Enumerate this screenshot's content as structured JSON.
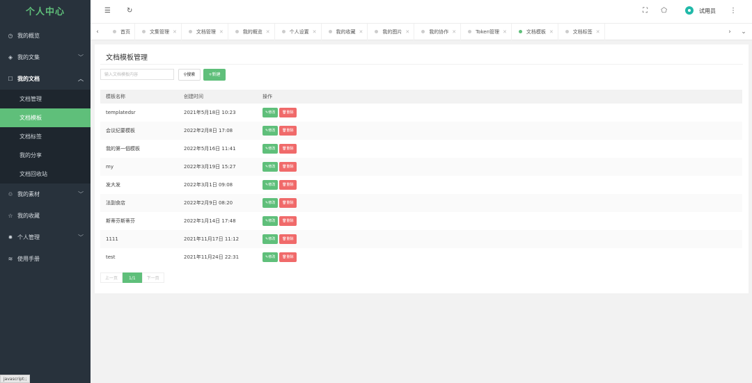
{
  "sidebar": {
    "brand": "个人中心",
    "items": [
      {
        "label": "我的概览",
        "icon": "dashboard-icon"
      },
      {
        "label": "我的文集",
        "icon": "books-icon",
        "has_children": true
      },
      {
        "label": "我的文档",
        "icon": "document-icon",
        "has_children": true,
        "open": true
      }
    ],
    "sub_items": [
      {
        "label": "文档管理",
        "active": false
      },
      {
        "label": "文档模板",
        "active": true
      },
      {
        "label": "文档标签",
        "active": false
      },
      {
        "label": "我的分享",
        "active": false
      },
      {
        "label": "文档回收站",
        "active": false
      }
    ],
    "items_after": [
      {
        "label": "我的素材",
        "icon": "materials-icon",
        "has_children": true
      },
      {
        "label": "我的收藏",
        "icon": "star-icon",
        "has_children": false
      },
      {
        "label": "个人管理",
        "icon": "gear-icon",
        "has_children": true
      },
      {
        "label": "使用手册",
        "icon": "manual-icon",
        "has_children": false
      }
    ],
    "statusbar": "javascript:;"
  },
  "topbar": {
    "user_name": "试用员"
  },
  "tabs": [
    {
      "label": "首页",
      "closable": false,
      "active": false
    },
    {
      "label": "文集管理",
      "closable": true,
      "active": false
    },
    {
      "label": "文档管理",
      "closable": true,
      "active": false
    },
    {
      "label": "我的概览",
      "closable": true,
      "active": false
    },
    {
      "label": "个人设置",
      "closable": true,
      "active": false
    },
    {
      "label": "我的收藏",
      "closable": true,
      "active": false
    },
    {
      "label": "我的图片",
      "closable": true,
      "active": false
    },
    {
      "label": "我的协作",
      "closable": true,
      "active": false
    },
    {
      "label": "Token管理",
      "closable": true,
      "active": false
    },
    {
      "label": "文档模板",
      "closable": true,
      "active": true
    },
    {
      "label": "文档标签",
      "closable": true,
      "active": false
    }
  ],
  "page": {
    "title": "文档模板管理",
    "search_placeholder": "输入文档模板内容",
    "search_label": "搜索",
    "new_label": "+新建",
    "columns": [
      "模板名称",
      "创建时间",
      "操作"
    ],
    "edit_label": "修改",
    "delete_label": "删除",
    "rows": [
      {
        "name": "templatedsr",
        "created": "2021年5月18日 10:23"
      },
      {
        "name": "会议纪要模板",
        "created": "2022年2月8日 17:08"
      },
      {
        "name": "我的第一個模板",
        "created": "2022年5月16日 11:41"
      },
      {
        "name": "my",
        "created": "2022年3月19日 15:27"
      },
      {
        "name": "发大发",
        "created": "2022年3月1日 09:08"
      },
      {
        "name": "法副食店",
        "created": "2022年2月9日 08:20"
      },
      {
        "name": "斯蒂芬斯蒂芬",
        "created": "2022年1月14日 17:48"
      },
      {
        "name": "1111",
        "created": "2021年11月17日 11:12"
      },
      {
        "name": "test",
        "created": "2021年11月24日 22:31"
      }
    ],
    "pager": {
      "prev": "上一页",
      "current": "1/1",
      "next": "下一页"
    }
  },
  "colors": {
    "accent": "#5fbf7a",
    "danger": "#f06a6a",
    "sidebar_bg": "#28323c"
  }
}
